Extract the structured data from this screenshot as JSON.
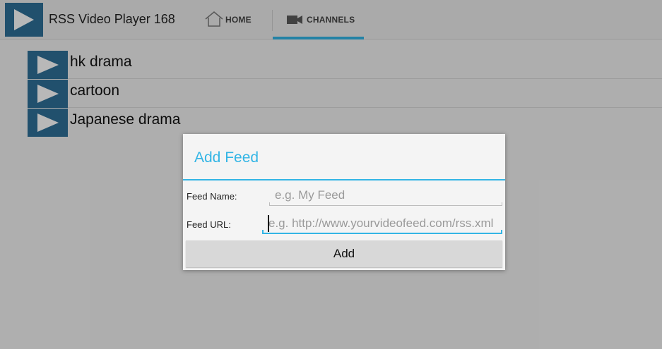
{
  "app": {
    "title": "RSS Video Player 168",
    "icon": "play-icon"
  },
  "tabs": [
    {
      "label": "HOME",
      "icon": "home-icon",
      "selected": false
    },
    {
      "label": "CHANNELS",
      "icon": "video-camera-icon",
      "selected": true
    }
  ],
  "channels": [
    {
      "label": "hk drama",
      "icon": "play-icon"
    },
    {
      "label": "cartoon",
      "icon": "play-icon"
    },
    {
      "label": "Japanese drama",
      "icon": "play-icon"
    }
  ],
  "dialog": {
    "title": "Add Feed",
    "feed_name": {
      "label": "Feed Name:",
      "value": "",
      "placeholder": "e.g. My Feed"
    },
    "feed_url": {
      "label": "Feed URL:",
      "value": "",
      "placeholder": "e.g. http://www.yourvideofeed.com/rss.xml",
      "focused": true
    },
    "add_button": "Add"
  },
  "colors": {
    "accent": "#33b5e5",
    "thumb": "#2f6f97"
  }
}
